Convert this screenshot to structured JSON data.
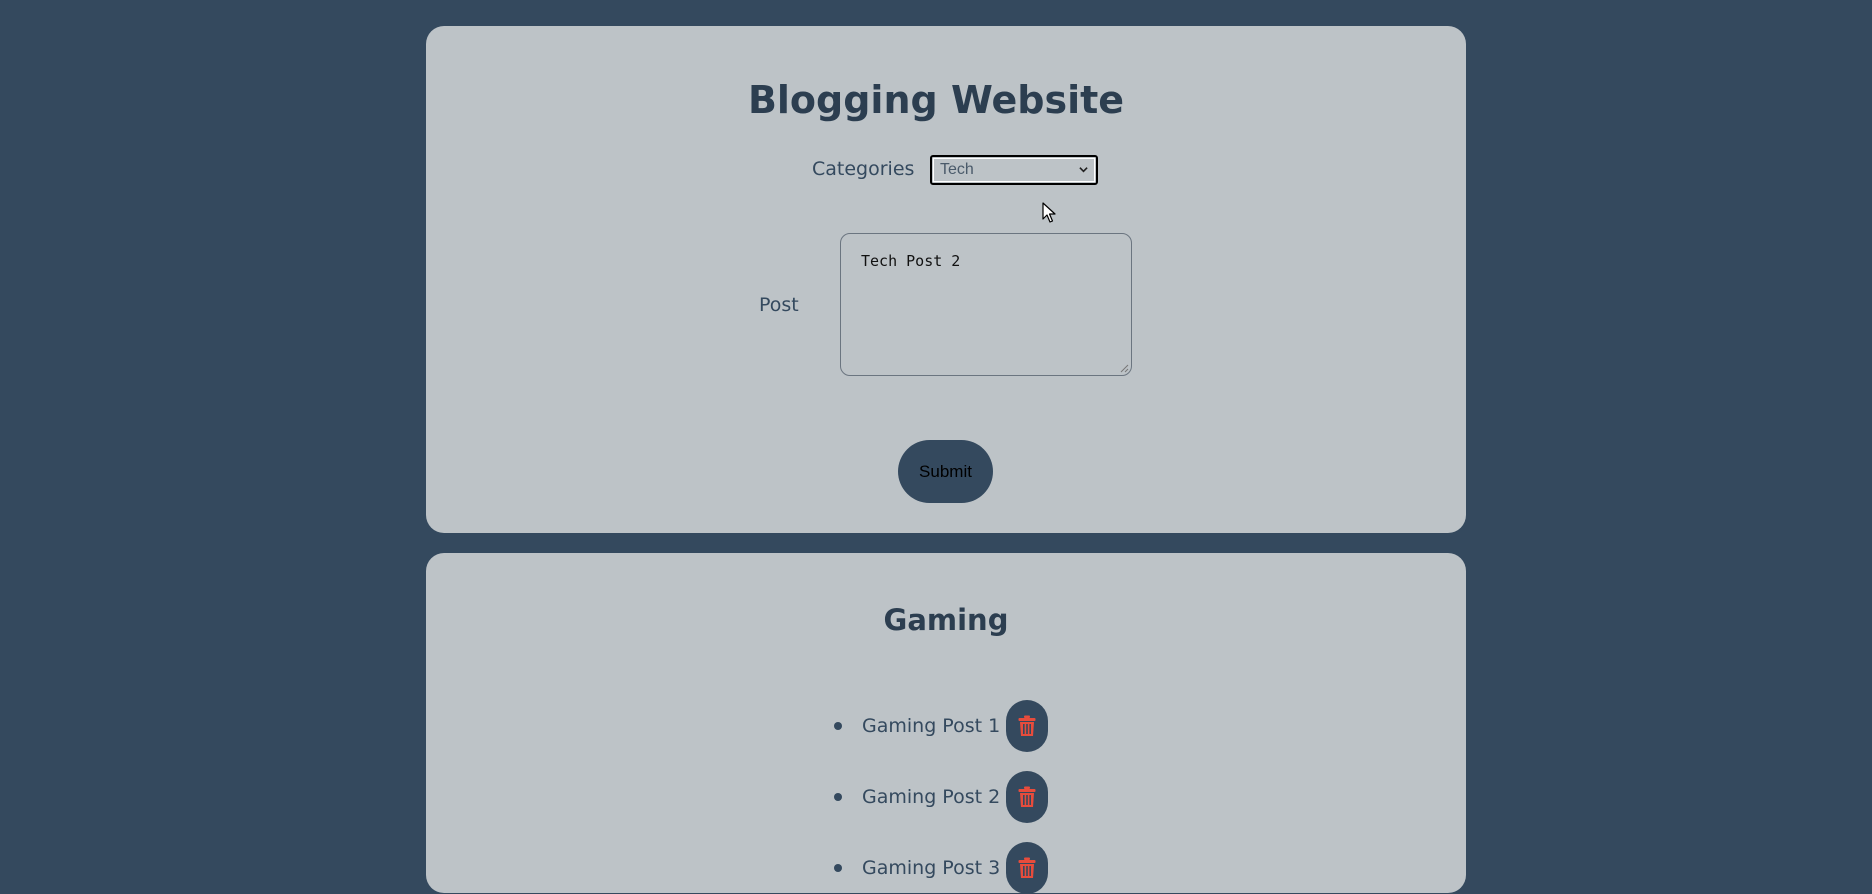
{
  "header": {
    "title": "Blogging Website"
  },
  "form": {
    "categories_label": "Categories",
    "selected_category": "Tech",
    "post_label": "Post",
    "post_value": "Tech Post 2",
    "submit_label": "Submit"
  },
  "section": {
    "title": "Gaming",
    "posts": [
      {
        "title": "Gaming Post 1",
        "delete_icon": "trash-icon"
      },
      {
        "title": "Gaming Post 2",
        "delete_icon": "trash-icon"
      },
      {
        "title": "Gaming Post 3",
        "delete_icon": "trash-icon"
      }
    ]
  },
  "colors": {
    "background": "#34495e",
    "card": "#bdc3c7",
    "heading": "#2c3e50",
    "delete_icon": "#e74c3c"
  }
}
